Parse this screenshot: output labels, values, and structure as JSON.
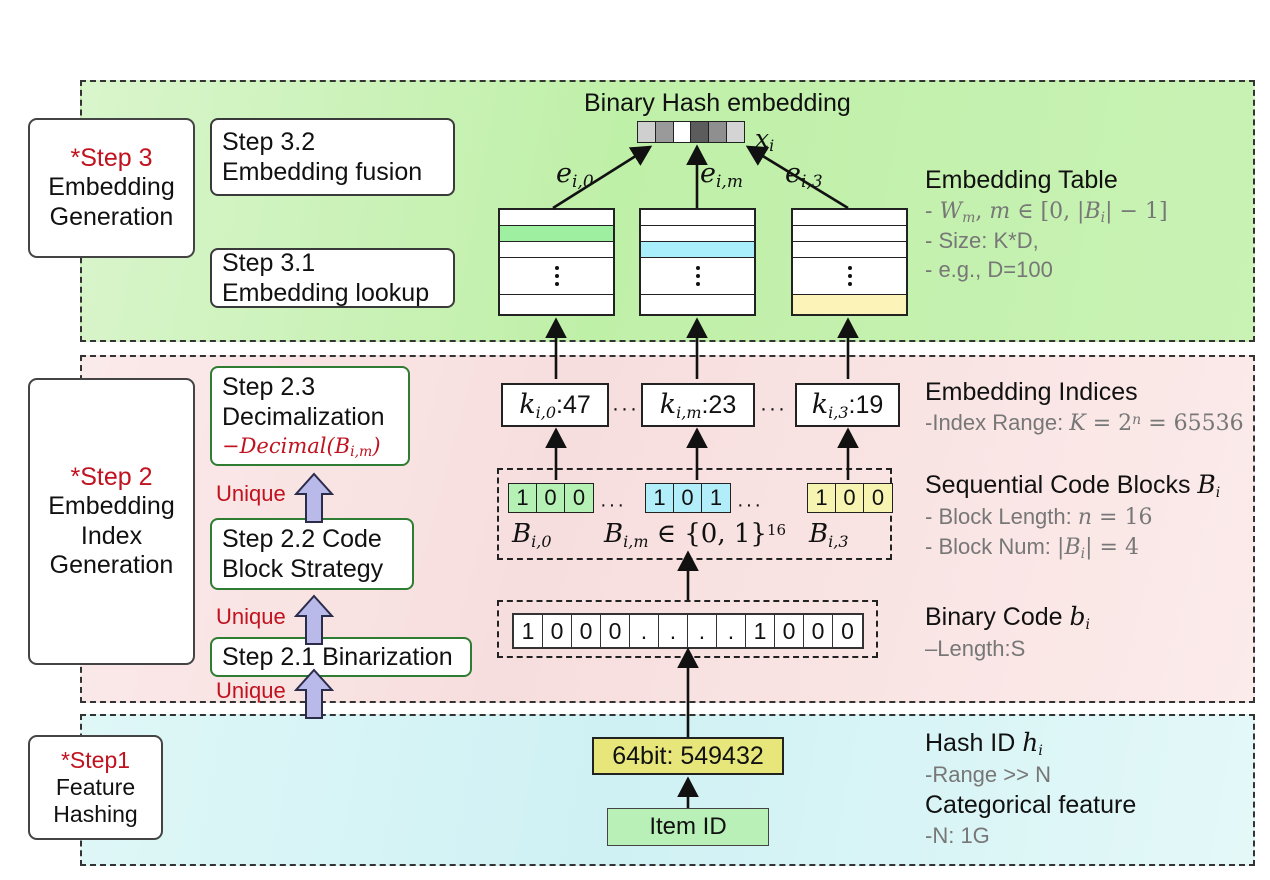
{
  "sections": {
    "step3": {
      "card": {
        "title": "*Step 3",
        "line1": "Embedding",
        "line2": "Generation"
      },
      "sub_boxes": [
        {
          "line1": "Step 3.2",
          "line2": "Embedding fusion"
        },
        {
          "line1": "Step 3.1",
          "line2": "Embedding lookup"
        }
      ],
      "center_title": "Binary Hash embedding",
      "output_symbol": "x",
      "output_symbol_sub": "i",
      "hash_bar_cells": [
        "#cfcfcf",
        "#9a9a9a",
        "#ffffff",
        "#5c5c5c",
        "#8f8f8f",
        "#d4d4d4"
      ],
      "edge_labels": [
        {
          "base": "e",
          "sub": "i,0"
        },
        {
          "base": "e",
          "sub": "i,m"
        },
        {
          "base": "e",
          "sub": "i,3"
        }
      ],
      "tables": [
        {
          "highlight_row": 2,
          "highlight_color": "#9ef0a0"
        },
        {
          "highlight_row": 3,
          "highlight_color": "#a8eefb"
        },
        {
          "highlight_row": 5,
          "highlight_color": "#fbf3b8"
        }
      ],
      "annotation": {
        "heading": "Embedding Table",
        "lines": [
          "- Size: K*D,",
          "- e.g., D=100"
        ],
        "math_line": "- W_m, m ∈ [0, |B_i| − 1]"
      }
    },
    "step2": {
      "card": {
        "title": "*Step 2",
        "line1": "Embedding",
        "line2": "Index",
        "line3": "Generation"
      },
      "sub_boxes": [
        {
          "line1": "Step 2.3",
          "line2": "Decimalization",
          "math": "−Decimal(B",
          "math_sub": "i,m",
          "math_tail": ")"
        },
        {
          "line1": "Step 2.2 Code",
          "line2": "Block Strategy"
        },
        {
          "line1": "Step 2.1 Binarization"
        }
      ],
      "unique_labels": [
        "Unique",
        "Unique",
        "Unique"
      ],
      "index_boxes": [
        {
          "base": "k",
          "sub": "i,0",
          "value": ":47"
        },
        {
          "base": "k",
          "sub": "i,m",
          "value": ":23"
        },
        {
          "base": "k",
          "sub": "i,3",
          "value": ":19"
        }
      ],
      "index_ellipsis": [
        "···",
        "···"
      ],
      "code_blocks": [
        {
          "bits": [
            "1",
            "0",
            "0"
          ],
          "color": "#b5f0b5",
          "label_base": "B",
          "label_sub": "i,0"
        },
        {
          "bits": [
            "1",
            "0",
            "1"
          ],
          "color": "#b2eef9",
          "label_base": "B",
          "label_sub": "i,m"
        },
        {
          "bits": [
            "1",
            "0",
            "0"
          ],
          "color": "#f7f4b2",
          "label_base": "B",
          "label_sub": "i,3"
        }
      ],
      "code_block_ellipsis": [
        "···",
        "···"
      ],
      "code_block_middle_label": {
        "base": "B",
        "sub": "i,m",
        "rest": " ∈ {0, 1}",
        "sup": "16"
      },
      "binary_code_bits": [
        "1",
        "0",
        "0",
        "0",
        ".",
        ".",
        ".",
        ".",
        "1",
        "0",
        "0",
        "0"
      ],
      "annotations": {
        "indices": {
          "heading": "Embedding Indices",
          "detail_prefix": "-Index Range: ",
          "detail_math": "K = 2ⁿ = 65536"
        },
        "code_blocks": {
          "heading": "Sequential Code Blocks",
          "heading_math_base": "B",
          "heading_math_sub": "i",
          "line1_prefix": "- Block Length: ",
          "line1_math": "n = 16",
          "line2_prefix": "- Block Num: ",
          "line2_math": "|B_i| = 4"
        },
        "binary_code": {
          "heading": "Binary Code",
          "heading_math_base": "b",
          "heading_math_sub": "i",
          "detail": "–Length:S"
        }
      }
    },
    "step1": {
      "card": {
        "title": "*Step1",
        "line1": "Feature",
        "line2": "Hashing"
      },
      "hash_id_box": "64bit: 549432",
      "item_id_box": "Item ID",
      "annotations": {
        "hash_id": {
          "heading": "Hash ID",
          "heading_math_base": "h",
          "heading_math_sub": "i",
          "detail": "-Range >> N"
        },
        "categorical": {
          "heading": "Categorical feature",
          "detail": "-N: 1G"
        }
      }
    }
  },
  "colors": {
    "step3_band": "#bff0a8",
    "step2_band": "#f7dede",
    "step1_band": "#cff1f4",
    "accent_red": "#c1121f",
    "arrow_purple": "#b9b9ea",
    "box_border_green": "#2f7d32",
    "muted_text": "#777777"
  }
}
